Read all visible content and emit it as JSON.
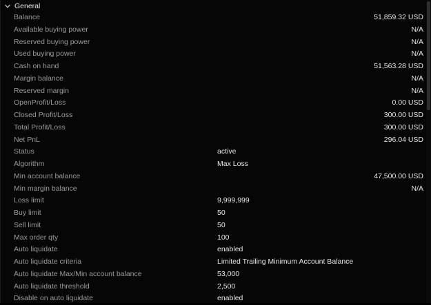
{
  "section": {
    "title": "General",
    "icon": "chevron-down-icon"
  },
  "rows": [
    {
      "label": "Balance",
      "value": "51,859.32 USD",
      "align": "right"
    },
    {
      "label": "Available buying power",
      "value": "N/A",
      "align": "right"
    },
    {
      "label": "Reserved buying power",
      "value": "N/A",
      "align": "right"
    },
    {
      "label": "Used buying power",
      "value": "N/A",
      "align": "right"
    },
    {
      "label": "Cash on hand",
      "value": "51,563.28 USD",
      "align": "right"
    },
    {
      "label": "Margin balance",
      "value": "N/A",
      "align": "right"
    },
    {
      "label": "Reserved margin",
      "value": "N/A",
      "align": "right"
    },
    {
      "label": "OpenProfit/Loss",
      "value": "0.00 USD",
      "align": "right"
    },
    {
      "label": "Closed Profit/Loss",
      "value": "300.00 USD",
      "align": "right"
    },
    {
      "label": "Total Profit/Loss",
      "value": "300.00 USD",
      "align": "right"
    },
    {
      "label": "Net PnL",
      "value": "296.04 USD",
      "align": "right"
    },
    {
      "label": "Status",
      "value": "active",
      "align": "mid"
    },
    {
      "label": "Algorithm",
      "value": "Max Loss",
      "align": "mid"
    },
    {
      "label": "Min account balance",
      "value": "47,500.00 USD",
      "align": "right"
    },
    {
      "label": "Min margin balance",
      "value": "N/A",
      "align": "right"
    },
    {
      "label": "Loss limit",
      "value": "9,999,999",
      "align": "mid"
    },
    {
      "label": "Buy limit",
      "value": "50",
      "align": "mid"
    },
    {
      "label": "Sell limit",
      "value": "50",
      "align": "mid"
    },
    {
      "label": "Max order qty",
      "value": "100",
      "align": "mid"
    },
    {
      "label": "Auto liquidate",
      "value": "enabled",
      "align": "mid"
    },
    {
      "label": "Auto liquidate criteria",
      "value": "Limited Trailing Minimum Account Balance",
      "align": "mid"
    },
    {
      "label": "Auto liquidate Max/Min account balance",
      "value": "53,000",
      "align": "mid"
    },
    {
      "label": "Auto liquidate threshold",
      "value": "2,500",
      "align": "mid"
    },
    {
      "label": "Disable on auto liquidate",
      "value": "enabled",
      "align": "mid"
    }
  ]
}
